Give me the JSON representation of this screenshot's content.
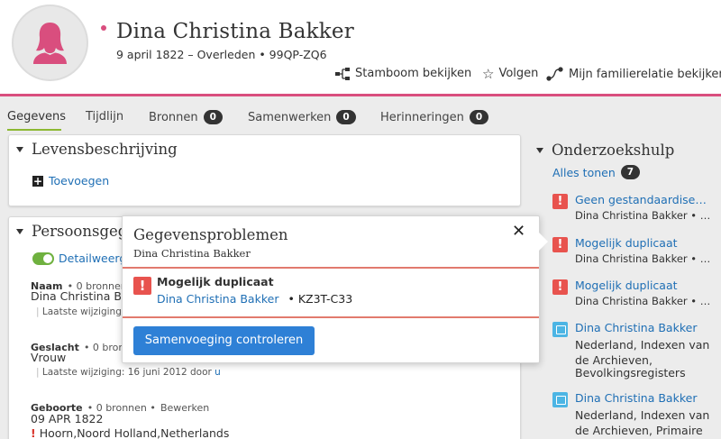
{
  "header": {
    "name": "Dina Christina Bakker",
    "subtitle": "9 april 1822 – Overleden • 99QP-ZQ6",
    "actions": {
      "tree": "Stamboom bekijken",
      "follow": "Volgen",
      "relationship": "Mijn familierelatie bekijken"
    },
    "accent_color": "#d94e7e"
  },
  "tabs": [
    {
      "label": "Gegevens",
      "count": null,
      "active": true
    },
    {
      "label": "Tijdlijn",
      "count": null,
      "active": false
    },
    {
      "label": "Bronnen",
      "count": "0",
      "active": false
    },
    {
      "label": "Samenwerken",
      "count": "0",
      "active": false
    },
    {
      "label": "Herinneringen",
      "count": "0",
      "active": false
    }
  ],
  "life_sketch": {
    "title": "Levensbeschrijving",
    "add_label": "Toevoegen"
  },
  "vitals": {
    "title": "Persoonsgeg",
    "detail_toggle": "Detailweerg",
    "fields": {
      "name": {
        "label": "Naam",
        "meta": "• 0 bronnen",
        "value": "Dina Christina B",
        "note": "Laatste wijziging"
      },
      "sex": {
        "label": "Geslacht",
        "meta": "• 0 bron",
        "value": "Vrouw",
        "note": "Laatste wijziging: 16 juni 2012 door",
        "note_link": "u"
      },
      "birth": {
        "label": "Geboorte",
        "meta": "• 0 bronnen •",
        "edit": "Bewerken",
        "date": "09 APR 1822",
        "place": "Hoorn,Noord Holland,Netherlands"
      }
    }
  },
  "research_help": {
    "title": "Onderzoekshulp",
    "show_all": "Alles tonen",
    "show_all_count": "7",
    "items": [
      {
        "type": "warning",
        "title": "Geen gestandaardise…",
        "sub": "Dina Christina Bakker  • …"
      },
      {
        "type": "warning",
        "title": "Mogelijk duplicaat",
        "sub": "Dina Christina Bakker  • …"
      },
      {
        "type": "warning",
        "title": "Mogelijk duplicaat",
        "sub": "Dina Christina Bakker  • …"
      },
      {
        "type": "record",
        "title": "Dina Christina Bakker",
        "lines": [
          "Nederland, Indexen van",
          "de Archieven,",
          "Bevolkingsregisters"
        ]
      },
      {
        "type": "record",
        "title": "Dina Christina Bakker",
        "lines": [
          "Nederland, Indexen van",
          "de Archieven, Primaire"
        ]
      }
    ]
  },
  "popover": {
    "title": "Gegevensproblemen",
    "subtitle": "Dina Christina Bakker",
    "close": "✕",
    "issue_title": "Mogelijk duplicaat",
    "issue_person": "Dina Christina Bakker",
    "issue_id": "KZ3T-C33",
    "button": "Samenvoeging controleren"
  }
}
